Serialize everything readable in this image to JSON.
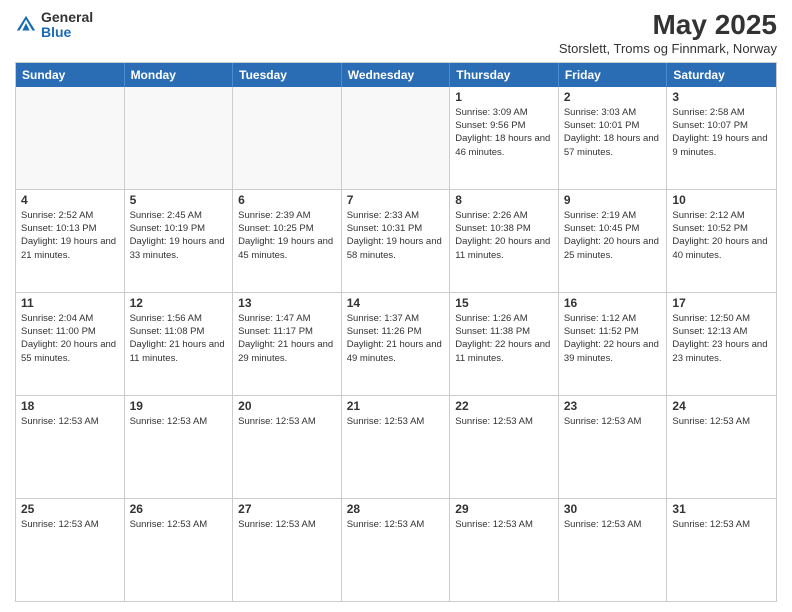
{
  "header": {
    "logo_general": "General",
    "logo_blue": "Blue",
    "month_title": "May 2025",
    "location": "Storslett, Troms og Finnmark, Norway"
  },
  "day_headers": [
    "Sunday",
    "Monday",
    "Tuesday",
    "Wednesday",
    "Thursday",
    "Friday",
    "Saturday"
  ],
  "weeks": [
    [
      {
        "day": "",
        "info": "",
        "empty": true
      },
      {
        "day": "",
        "info": "",
        "empty": true
      },
      {
        "day": "",
        "info": "",
        "empty": true
      },
      {
        "day": "",
        "info": "",
        "empty": true
      },
      {
        "day": "1",
        "info": "Sunrise: 3:09 AM\nSunset: 9:56 PM\nDaylight: 18 hours\nand 46 minutes."
      },
      {
        "day": "2",
        "info": "Sunrise: 3:03 AM\nSunset: 10:01 PM\nDaylight: 18 hours\nand 57 minutes."
      },
      {
        "day": "3",
        "info": "Sunrise: 2:58 AM\nSunset: 10:07 PM\nDaylight: 19 hours\nand 9 minutes."
      }
    ],
    [
      {
        "day": "4",
        "info": "Sunrise: 2:52 AM\nSunset: 10:13 PM\nDaylight: 19 hours\nand 21 minutes."
      },
      {
        "day": "5",
        "info": "Sunrise: 2:45 AM\nSunset: 10:19 PM\nDaylight: 19 hours\nand 33 minutes."
      },
      {
        "day": "6",
        "info": "Sunrise: 2:39 AM\nSunset: 10:25 PM\nDaylight: 19 hours\nand 45 minutes."
      },
      {
        "day": "7",
        "info": "Sunrise: 2:33 AM\nSunset: 10:31 PM\nDaylight: 19 hours\nand 58 minutes."
      },
      {
        "day": "8",
        "info": "Sunrise: 2:26 AM\nSunset: 10:38 PM\nDaylight: 20 hours\nand 11 minutes."
      },
      {
        "day": "9",
        "info": "Sunrise: 2:19 AM\nSunset: 10:45 PM\nDaylight: 20 hours\nand 25 minutes."
      },
      {
        "day": "10",
        "info": "Sunrise: 2:12 AM\nSunset: 10:52 PM\nDaylight: 20 hours\nand 40 minutes."
      }
    ],
    [
      {
        "day": "11",
        "info": "Sunrise: 2:04 AM\nSunset: 11:00 PM\nDaylight: 20 hours\nand 55 minutes."
      },
      {
        "day": "12",
        "info": "Sunrise: 1:56 AM\nSunset: 11:08 PM\nDaylight: 21 hours\nand 11 minutes."
      },
      {
        "day": "13",
        "info": "Sunrise: 1:47 AM\nSunset: 11:17 PM\nDaylight: 21 hours\nand 29 minutes."
      },
      {
        "day": "14",
        "info": "Sunrise: 1:37 AM\nSunset: 11:26 PM\nDaylight: 21 hours\nand 49 minutes."
      },
      {
        "day": "15",
        "info": "Sunrise: 1:26 AM\nSunset: 11:38 PM\nDaylight: 22 hours\nand 11 minutes."
      },
      {
        "day": "16",
        "info": "Sunrise: 1:12 AM\nSunset: 11:52 PM\nDaylight: 22 hours\nand 39 minutes."
      },
      {
        "day": "17",
        "info": "Sunrise: 12:50 AM\nSunset: 12:13 AM\nDaylight: 23 hours\nand 23 minutes."
      }
    ],
    [
      {
        "day": "18",
        "info": "Sunrise: 12:53 AM"
      },
      {
        "day": "19",
        "info": "Sunrise: 12:53 AM"
      },
      {
        "day": "20",
        "info": "Sunrise: 12:53 AM"
      },
      {
        "day": "21",
        "info": "Sunrise: 12:53 AM"
      },
      {
        "day": "22",
        "info": "Sunrise: 12:53 AM"
      },
      {
        "day": "23",
        "info": "Sunrise: 12:53 AM"
      },
      {
        "day": "24",
        "info": "Sunrise: 12:53 AM"
      }
    ],
    [
      {
        "day": "25",
        "info": "Sunrise: 12:53 AM"
      },
      {
        "day": "26",
        "info": "Sunrise: 12:53 AM"
      },
      {
        "day": "27",
        "info": "Sunrise: 12:53 AM"
      },
      {
        "day": "28",
        "info": "Sunrise: 12:53 AM"
      },
      {
        "day": "29",
        "info": "Sunrise: 12:53 AM"
      },
      {
        "day": "30",
        "info": "Sunrise: 12:53 AM"
      },
      {
        "day": "31",
        "info": "Sunrise: 12:53 AM"
      }
    ]
  ]
}
